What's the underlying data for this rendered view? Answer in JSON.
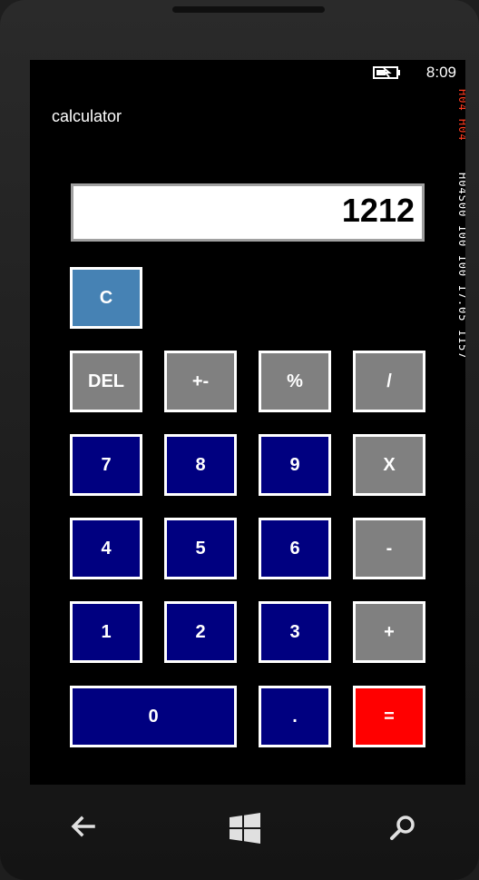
{
  "status_bar": {
    "time": "8:09",
    "battery_icon": "battery-charging-icon"
  },
  "app": {
    "title": "calculator"
  },
  "display": {
    "value": "1212"
  },
  "keys": {
    "clear": "C",
    "del": "DEL",
    "plus_minus": "+-",
    "percent": "%",
    "divide": "/",
    "seven": "7",
    "eight": "8",
    "nine": "9",
    "multiply": "X",
    "four": "4",
    "five": "5",
    "six": "6",
    "minus": "-",
    "one": "1",
    "two": "2",
    "three": "3",
    "plus": "+",
    "zero": "0",
    "decimal": ".",
    "equals": "="
  },
  "debug_counters": {
    "red": "H04 H04",
    "white": "H04S00 100 100 17.05 1157"
  },
  "colors": {
    "operator": "#808080",
    "digit": "#000080",
    "clear": "#4682b4",
    "equals": "#ff0000"
  },
  "nav_bar": {
    "back_icon": "back-arrow-icon",
    "start_icon": "windows-logo-icon",
    "search_icon": "search-icon"
  }
}
